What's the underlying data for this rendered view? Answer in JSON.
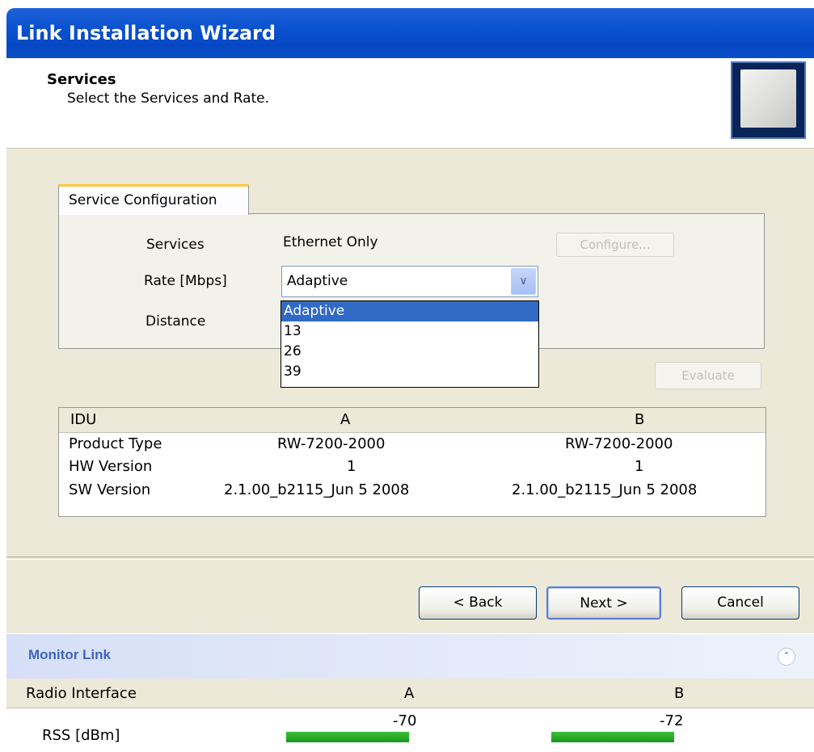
{
  "window": {
    "title": "Link Installation Wizard"
  },
  "header": {
    "title": "Services",
    "subtitle": "Select the Services and Rate."
  },
  "tab": {
    "label": "Service Configuration"
  },
  "form": {
    "services_label": "Services",
    "services_value": "Ethernet Only",
    "configure_label": "Configure...",
    "rate_label": "Rate [Mbps]",
    "rate_value": "Adaptive",
    "distance_label": "Distance",
    "rate_options": [
      "Adaptive",
      "13",
      "26",
      "39"
    ],
    "evaluate_label": "Evaluate"
  },
  "idu_table": {
    "headers": [
      "IDU",
      "A",
      "B"
    ],
    "rows": [
      [
        "Product Type",
        "RW-7200-2000",
        "RW-7200-2000"
      ],
      [
        "HW Version",
        "1",
        "1"
      ],
      [
        "SW Version",
        "2.1.00_b2115_Jun  5 2008",
        "2.1.00_b2115_Jun  5 2008"
      ]
    ]
  },
  "buttons": {
    "back": "< Back",
    "next": "Next >",
    "cancel": "Cancel"
  },
  "monitor": {
    "title": "Monitor Link",
    "headers": [
      "Radio Interface",
      "A",
      "B"
    ],
    "rss_label": "RSS [dBm]",
    "rss_a": "-70",
    "rss_b": "-72"
  },
  "colors": {
    "titlebar": "#0a52d0",
    "selection": "#316ac5",
    "rss_bar": "#22a322"
  }
}
